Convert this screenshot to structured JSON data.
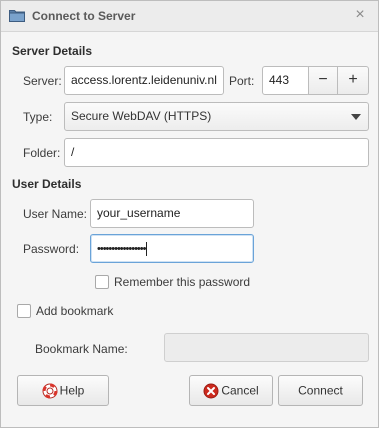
{
  "window": {
    "title": "Connect to Server",
    "close_glyph": "×",
    "icon": "folder-icon"
  },
  "server_details": {
    "heading": "Server Details",
    "server_label": "Server:",
    "server_value": "access.lorentz.leidenuniv.nl",
    "port_label": "Port:",
    "port_value": "443",
    "decrement_glyph": "−",
    "increment_glyph": "+",
    "type_label": "Type:",
    "type_value": "Secure WebDAV (HTTPS)",
    "folder_label": "Folder:",
    "folder_value": "/"
  },
  "user_details": {
    "heading": "User Details",
    "username_label": "User Name:",
    "username_value": "your_username",
    "password_label": "Password:",
    "password_value": "•••••••••••••••••",
    "remember_label": "Remember this password",
    "remember_checked": false
  },
  "bookmark": {
    "add_label": "Add bookmark",
    "add_checked": false,
    "name_label": "Bookmark Name:",
    "name_value": ""
  },
  "buttons": {
    "help": "Help",
    "cancel": "Cancel",
    "connect": "Connect"
  },
  "colors": {
    "accent_focus": "#6aa3d8",
    "help_icon": "#d9342b",
    "cancel_icon": "#cc2a1e"
  }
}
